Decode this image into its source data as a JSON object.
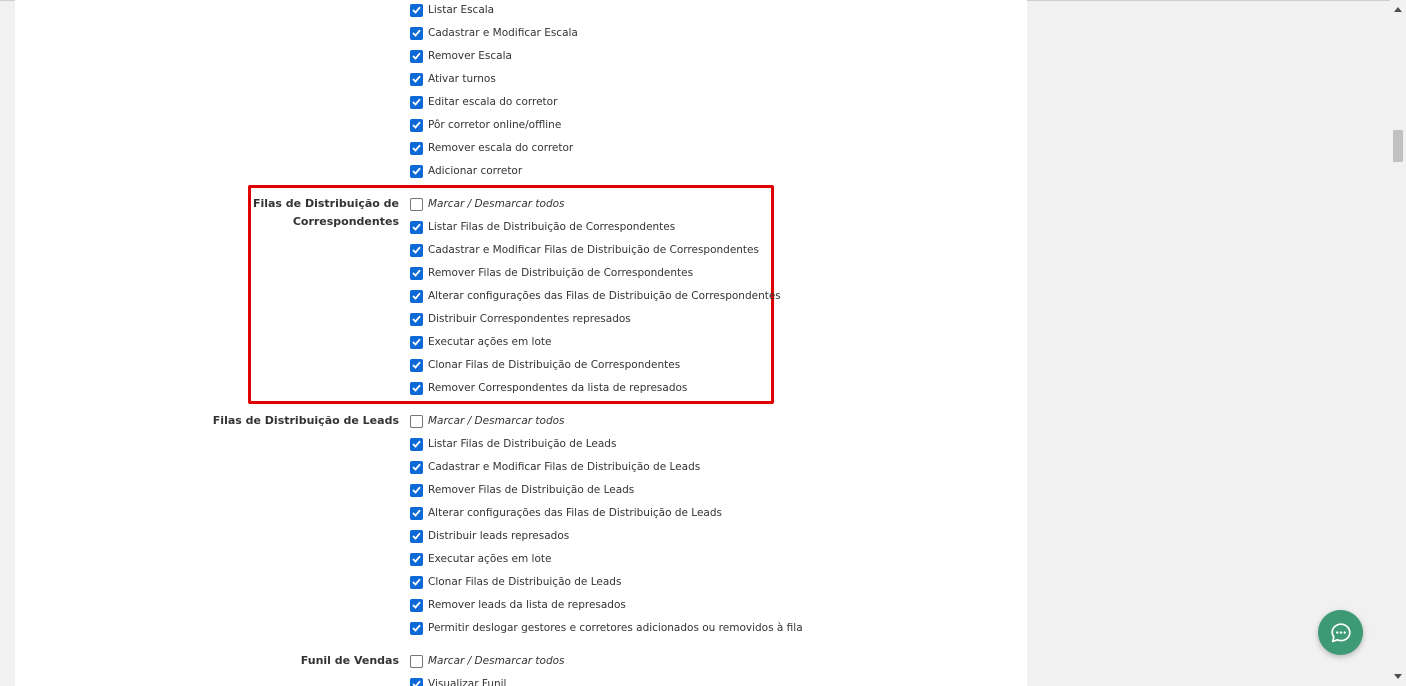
{
  "groups": [
    {
      "title": "",
      "options": [
        {
          "label": "Listar Escala",
          "checked": true
        },
        {
          "label": "Cadastrar e Modificar Escala",
          "checked": true
        },
        {
          "label": "Remover Escala",
          "checked": true
        },
        {
          "label": "Ativar turnos",
          "checked": true
        },
        {
          "label": "Editar escala do corretor",
          "checked": true
        },
        {
          "label": "Pôr corretor online/offline",
          "checked": true
        },
        {
          "label": "Remover escala do corretor",
          "checked": true
        },
        {
          "label": "Adicionar corretor",
          "checked": true
        }
      ]
    },
    {
      "title_lines": [
        "Filas de Distribuição de",
        "Correspondentes"
      ],
      "options": [
        {
          "label": "Marcar / Desmarcar todos",
          "checked": false,
          "italic": true
        },
        {
          "label": "Listar Filas de Distribuição de Correspondentes",
          "checked": true
        },
        {
          "label": "Cadastrar e Modificar Filas de Distribuição de Correspondentes",
          "checked": true
        },
        {
          "label": "Remover Filas de Distribuição de Correspondentes",
          "checked": true
        },
        {
          "label": "Alterar configurações das Filas de Distribuição de Correspondentes",
          "checked": true
        },
        {
          "label": "Distribuir Correspondentes represados",
          "checked": true
        },
        {
          "label": "Executar ações em lote",
          "checked": true
        },
        {
          "label": "Clonar Filas de Distribuição de Correspondentes",
          "checked": true
        },
        {
          "label": "Remover Correspondentes da lista de represados",
          "checked": true
        }
      ]
    },
    {
      "title": "Filas de Distribuição de Leads",
      "options": [
        {
          "label": "Marcar / Desmarcar todos",
          "checked": false,
          "italic": true
        },
        {
          "label": "Listar Filas de Distribuição de Leads",
          "checked": true
        },
        {
          "label": "Cadastrar e Modificar Filas de Distribuição de Leads",
          "checked": true
        },
        {
          "label": "Remover Filas de Distribuição de Leads",
          "checked": true
        },
        {
          "label": "Alterar configurações das Filas de Distribuição de Leads",
          "checked": true
        },
        {
          "label": "Distribuir leads represados",
          "checked": true
        },
        {
          "label": "Executar ações em lote",
          "checked": true
        },
        {
          "label": "Clonar Filas de Distribuição de Leads",
          "checked": true
        },
        {
          "label": "Remover leads da lista de represados",
          "checked": true
        },
        {
          "label": "Permitir deslogar gestores e corretores adicionados ou removidos à fila",
          "checked": true
        }
      ]
    },
    {
      "title": "Funil de Vendas",
      "options": [
        {
          "label": "Marcar / Desmarcar todos",
          "checked": false,
          "italic": true
        },
        {
          "label": "Visualizar Funil",
          "checked": true
        }
      ]
    }
  ],
  "colors": {
    "checkbox": "#0d69d6",
    "highlight": "#e10000",
    "chat": "#3d9a74"
  },
  "icons": {
    "chat": "chat-bubble-icon",
    "check": "checkmark-icon"
  }
}
